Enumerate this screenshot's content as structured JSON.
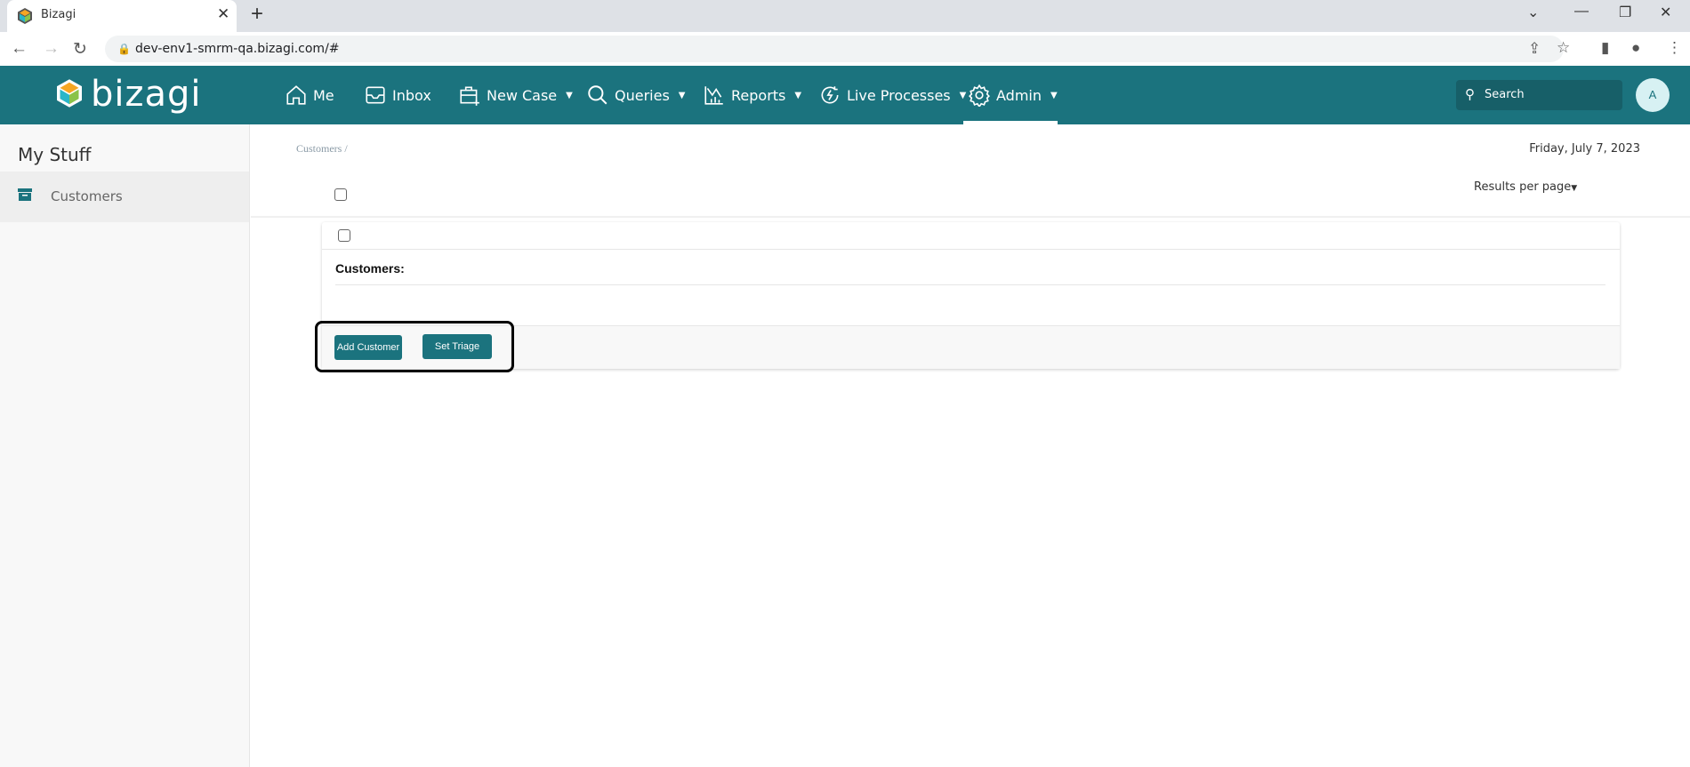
{
  "browser": {
    "tab_title": "Bizagi",
    "url": "dev-env1-smrm-qa.bizagi.com/#"
  },
  "nav": {
    "logo": "bizagi",
    "items": [
      {
        "label": "Me",
        "icon": "home-icon"
      },
      {
        "label": "Inbox",
        "icon": "inbox-icon"
      },
      {
        "label": "New Case",
        "icon": "new-case-icon",
        "dropdown": true
      },
      {
        "label": "Queries",
        "icon": "search-icon",
        "dropdown": true
      },
      {
        "label": "Reports",
        "icon": "reports-icon",
        "dropdown": true
      },
      {
        "label": "Live Processes",
        "icon": "live-processes-icon",
        "dropdown": true
      },
      {
        "label": "Admin",
        "icon": "gear-icon",
        "dropdown": true,
        "active": true
      }
    ],
    "search_placeholder": "Search",
    "avatar": "A",
    "color": "#1b737e"
  },
  "sidebar": {
    "title": "My Stuff",
    "items": [
      {
        "label": "Customers",
        "icon": "archive-icon",
        "selected": true
      }
    ]
  },
  "main": {
    "breadcrumb": "Customers /",
    "date": "Friday, July 7, 2023",
    "results_per_page": "Results per page",
    "form": {
      "label": "Customers:",
      "buttons": {
        "add": "Add Customer",
        "triage": "Set Triage"
      }
    }
  }
}
